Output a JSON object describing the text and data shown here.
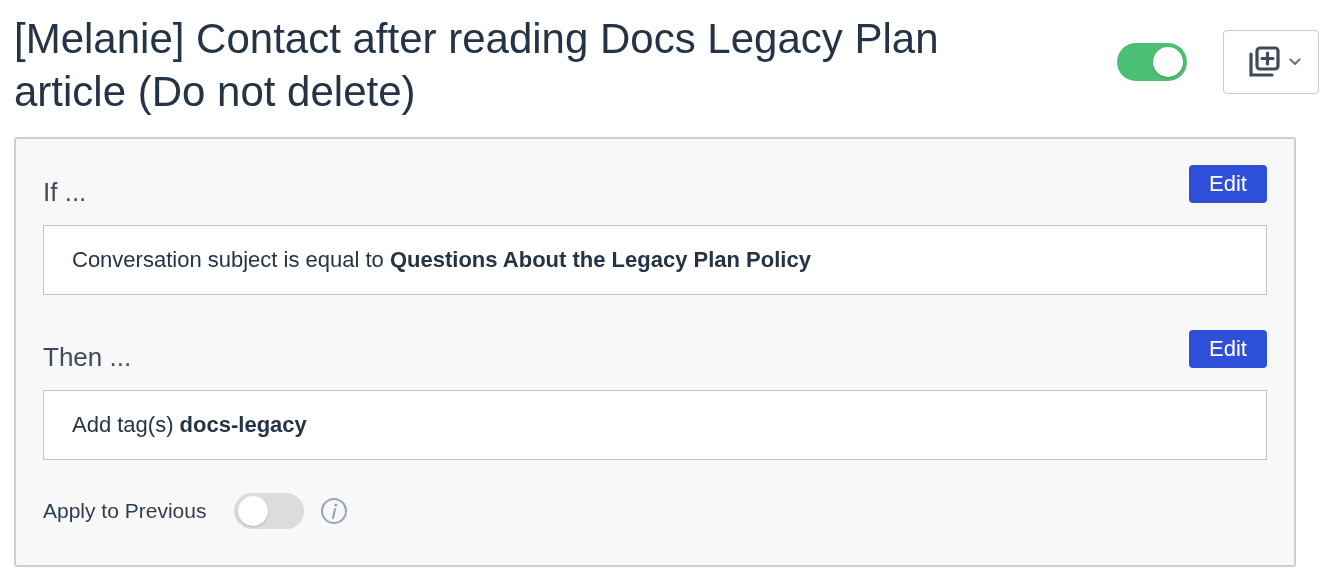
{
  "title": "[Melanie] Contact after reading Docs Legacy Plan article (Do not delete)",
  "enabled": {
    "on": true
  },
  "menu_button": {
    "kind": "duplicate"
  },
  "sections": [
    {
      "heading": "If ...",
      "button": "Edit",
      "text": "Conversation subject is equal to **Questions About the Legacy Plan Policy**"
    },
    {
      "heading": "Then ...",
      "button": "Edit",
      "text": "Add tag(s) **docs-legacy**"
    }
  ],
  "apply_to_previous": {
    "label": "Apply to Previous",
    "on": false
  }
}
